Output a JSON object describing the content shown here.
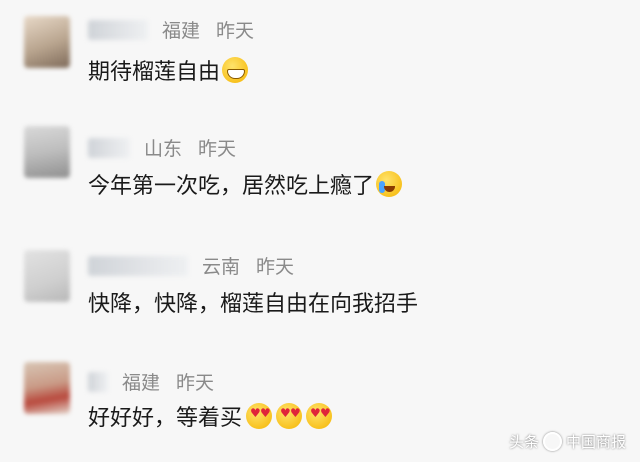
{
  "comments": [
    {
      "region": "福建",
      "time": "昨天",
      "text": "期待榴莲自由",
      "emojis": [
        "grinning-face"
      ]
    },
    {
      "region": "山东",
      "time": "昨天",
      "text": "今年第一次吃，居然吃上瘾了",
      "emojis": [
        "loudly-crying-face"
      ]
    },
    {
      "region": "云南",
      "time": "昨天",
      "text": "快降，快降，榴莲自由在向我招手",
      "emojis": []
    },
    {
      "region": "福建",
      "time": "昨天",
      "text": "好好好，等着买",
      "emojis": [
        "heart-eyes-face",
        "heart-eyes-face",
        "heart-eyes-face"
      ]
    }
  ],
  "watermark": {
    "prefix": "头条",
    "source": "中国商报"
  }
}
